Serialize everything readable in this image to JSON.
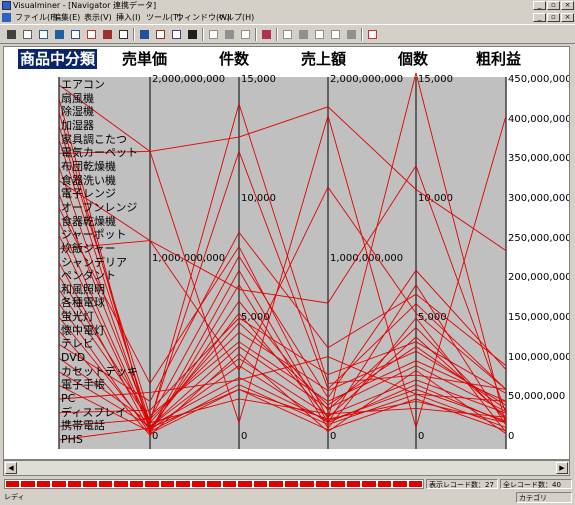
{
  "window": {
    "title": "Visualminer - [Navigator 連携データ]",
    "controls": {
      "minimize": "_",
      "restore": "▫",
      "close": "×"
    },
    "doc_controls": {
      "minimize": "_",
      "restore": "▫",
      "close": "×"
    }
  },
  "menu": [
    {
      "label": "ファイル(F)"
    },
    {
      "label": "編集(E)"
    },
    {
      "label": "表示(V)"
    },
    {
      "label": "挿入(I)"
    },
    {
      "label": "ツール(T)"
    },
    {
      "label": "ウィンドウ(W)"
    },
    {
      "label": "ヘルプ(H)"
    }
  ],
  "toolbar": [
    {
      "icon": "clip-icon",
      "color": "#404040"
    },
    {
      "icon": "sheet-icon",
      "color": "#606060"
    },
    {
      "icon": "grid-icon",
      "color": "#2060a0"
    },
    {
      "icon": "grid-small-icon",
      "color": "#2060a0"
    },
    {
      "icon": "save-icon",
      "color": "#3050a0"
    },
    {
      "icon": "bar-chart-icon",
      "color": "#c03030"
    },
    {
      "icon": "chart-line-icon",
      "color": "#a03030"
    },
    {
      "icon": "table-icon",
      "color": "#303030"
    },
    {
      "icon": "sep",
      "color": ""
    },
    {
      "icon": "parallel-icon",
      "color": "#2050a0"
    },
    {
      "icon": "network-icon",
      "color": "#903030"
    },
    {
      "icon": "merge-icon",
      "color": "#404080"
    },
    {
      "icon": "list-icon",
      "color": "#202020"
    },
    {
      "icon": "sep",
      "color": ""
    },
    {
      "icon": "plot-icon",
      "color": "#909090"
    },
    {
      "icon": "plot2-icon",
      "color": "#909090"
    },
    {
      "icon": "plot3-icon",
      "color": "#909090"
    },
    {
      "icon": "sep",
      "color": ""
    },
    {
      "icon": "filter-icon",
      "color": "#b03050"
    },
    {
      "icon": "sep",
      "color": ""
    },
    {
      "icon": "group-icon",
      "color": "#909090"
    },
    {
      "icon": "edit-icon",
      "color": "#909090"
    },
    {
      "icon": "arrow-icon",
      "color": "#909090"
    },
    {
      "icon": "brush-icon",
      "color": "#909090"
    },
    {
      "icon": "chart-small-icon",
      "color": "#909090"
    },
    {
      "icon": "sep",
      "color": ""
    },
    {
      "icon": "filter-red-icon",
      "color": "#d03030"
    }
  ],
  "axes": [
    {
      "name": "商品中分類",
      "selected": true
    },
    {
      "name": "売単価",
      "selected": false
    },
    {
      "name": "件数",
      "selected": false
    },
    {
      "name": "売上額",
      "selected": false
    },
    {
      "name": "個数",
      "selected": false
    },
    {
      "name": "粗利益",
      "selected": false
    }
  ],
  "categories": [
    "エアコン",
    "扇風機",
    "除湿機",
    "加湿器",
    "家具調こたつ",
    "電気カーペット",
    "布団乾燥機",
    "食器洗い機",
    "電子レンジ",
    "オーブンレンジ",
    "食器乾燥機",
    "ジャーポット",
    "炊飯ジャー",
    "シャンデリア",
    "ペンダント",
    "和風照明",
    "各種電球",
    "蛍光灯",
    "懐中電灯",
    "テレビ",
    "DVD",
    "カセットデッキ",
    "電子手帳",
    "PC",
    "ディスプレイ",
    "携帯電話",
    "PHS"
  ],
  "ticks": {
    "unit_price": [
      "2,000,000,000",
      "1,000,000,000",
      "0"
    ],
    "count": [
      "15,000",
      "10,000",
      "5,000",
      "0"
    ],
    "sales": [
      "2,000,000,000",
      "1,000,000,000",
      "0"
    ],
    "qty": [
      "15,000",
      "10,000",
      "5,000",
      "0"
    ],
    "profit": [
      "450,000,000",
      "400,000,000",
      "350,000,000",
      "300,000,000",
      "250,000,000",
      "200,000,000",
      "150,000,000",
      "100,000,000",
      "50,000,000",
      "0"
    ]
  },
  "chart_data": {
    "type": "parallel_coordinates",
    "line_color": "#e00000",
    "axes": [
      "商品中分類",
      "売単価",
      "件数",
      "売上額",
      "個数",
      "粗利益"
    ],
    "ranges": {
      "売単価": [
        0,
        2000000000
      ],
      "件数": [
        0,
        15000
      ],
      "売上額": [
        0,
        2000000000
      ],
      "個数": [
        0,
        15000
      ],
      "粗利益": [
        0,
        450000000
      ]
    },
    "rows": [
      {
        "category": "エアコン",
        "values": [
          1600000000,
          600,
          1800000000,
          400,
          405000000
        ]
      },
      {
        "category": "扇風機",
        "values": [
          20000000,
          2000,
          40000000,
          1600,
          8000000
        ]
      },
      {
        "category": "除湿機",
        "values": [
          40000000,
          3000,
          80000000,
          2200,
          18000000
        ]
      },
      {
        "category": "加湿器",
        "values": [
          120000000,
          4000,
          200000000,
          3200,
          45000000
        ]
      },
      {
        "category": "家具調こたつ",
        "values": [
          80000000,
          14000,
          300000000,
          2600,
          60000000
        ]
      },
      {
        "category": "電気カーペット",
        "values": [
          1600000000,
          12600,
          1850000000,
          10400,
          235000000
        ]
      },
      {
        "category": "布団乾燥機",
        "values": [
          60000000,
          3300,
          120000000,
          2400,
          30000000
        ]
      },
      {
        "category": "食器洗い機",
        "values": [
          1100000000,
          6200,
          750000000,
          11400,
          30000000
        ]
      },
      {
        "category": "電子レンジ",
        "values": [
          80000000,
          4800,
          180000000,
          3800,
          35000000
        ]
      },
      {
        "category": "オーブンレンジ",
        "values": [
          300000000,
          8000,
          100000000,
          15300,
          15000000
        ]
      },
      {
        "category": "食器乾燥機",
        "values": [
          60000000,
          2500,
          90000000,
          2000,
          20000000
        ]
      },
      {
        "category": "ジャーポット",
        "values": [
          50000000,
          5200,
          110000000,
          4200,
          25000000
        ]
      },
      {
        "category": "炊飯ジャー",
        "values": [
          1100000000,
          2800,
          1400000000,
          5200,
          60000000
        ]
      },
      {
        "category": "シャンデリア",
        "values": [
          30000000,
          2200,
          70000000,
          1800,
          12000000
        ]
      },
      {
        "category": "ペンダント",
        "values": [
          100000000,
          4400,
          260000000,
          3600,
          40000000
        ]
      },
      {
        "category": "和風照明",
        "values": [
          90000000,
          12000,
          270000000,
          5600,
          60000000
        ]
      },
      {
        "category": "各種電球",
        "values": [
          20000000,
          6400,
          50000000,
          5000,
          6000000
        ]
      },
      {
        "category": "蛍光灯",
        "values": [
          40000000,
          5700,
          150000000,
          4600,
          22000000
        ]
      },
      {
        "category": "懐中電灯",
        "values": [
          10000000,
          3500,
          30000000,
          2800,
          4000000
        ]
      },
      {
        "category": "テレビ",
        "values": [
          200000000,
          8600,
          500000000,
          6000,
          90000000
        ]
      },
      {
        "category": "DVD",
        "values": [
          80000000,
          1600,
          130000000,
          1200,
          25000000
        ]
      },
      {
        "category": "カセットデッキ",
        "values": [
          60000000,
          3800,
          160000000,
          3000,
          32000000
        ]
      },
      {
        "category": "電子手帳",
        "values": [
          30000000,
          7000,
          80000000,
          6400,
          15000000
        ]
      },
      {
        "category": "PC",
        "values": [
          250000000,
          2400,
          450000000,
          1800,
          45000000
        ]
      },
      {
        "category": "ディスプレイ",
        "values": [
          150000000,
          5000,
          350000000,
          4000,
          55000000
        ]
      },
      {
        "category": "携帯電話",
        "values": [
          100000000,
          7600,
          220000000,
          7000,
          85000000
        ]
      },
      {
        "category": "PHS",
        "values": [
          50000000,
          2000,
          100000000,
          1500,
          18000000
        ]
      }
    ]
  },
  "status": {
    "displayed": "表示レコード数：27",
    "total": "全レコード数：40",
    "ready": "レディ",
    "mode": "カテゴリ"
  },
  "progress_segments": 27
}
